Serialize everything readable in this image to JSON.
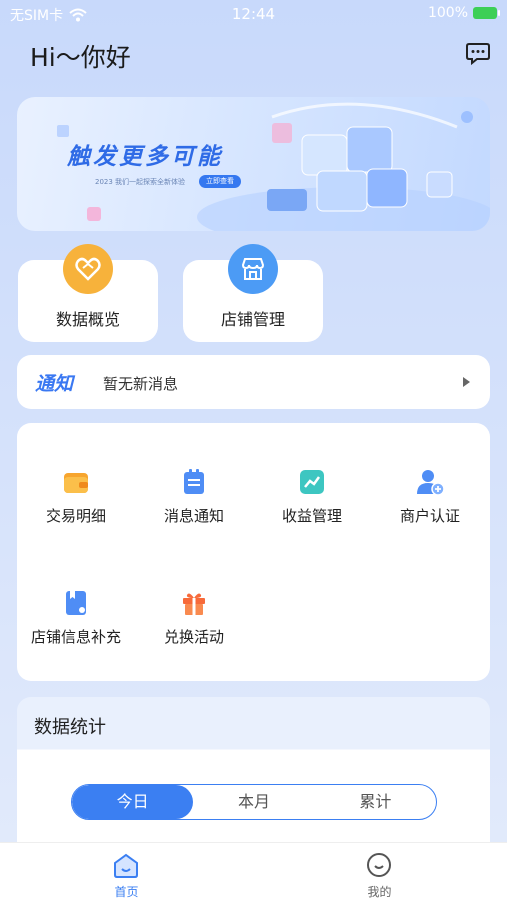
{
  "status_bar": {
    "carrier": "无SIM卡",
    "time": "12:44",
    "battery": "100%"
  },
  "header": {
    "greeting": "Hi～你好",
    "message_icon": "chat-bubble-icon"
  },
  "banner": {
    "title": "触发更多可能",
    "subtitle": "2023 我们一起探索全新体验",
    "button": "立即查看"
  },
  "quick_cards": [
    {
      "label": "数据概览",
      "icon": "heart-icon",
      "color": "#f7b23b"
    },
    {
      "label": "店铺管理",
      "icon": "store-icon",
      "color": "#4c9bf5"
    }
  ],
  "notice": {
    "tag": "通知",
    "text": "暂无新消息"
  },
  "grid": [
    {
      "label": "交易明细",
      "icon": "wallet-icon"
    },
    {
      "label": "消息通知",
      "icon": "calendar-icon"
    },
    {
      "label": "收益管理",
      "icon": "trend-chart-icon"
    },
    {
      "label": "商户认证",
      "icon": "user-add-icon"
    },
    {
      "label": "店铺信息补充",
      "icon": "bookmark-document-icon"
    },
    {
      "label": "兑换活动",
      "icon": "gift-icon"
    }
  ],
  "stats": {
    "title": "数据统计",
    "tabs": [
      "今日",
      "本月",
      "累计"
    ],
    "active_tab": "今日"
  },
  "tabbar": [
    {
      "label": "首页",
      "icon": "home-icon",
      "active": true
    },
    {
      "label": "我的",
      "icon": "profile-icon",
      "active": false
    }
  ],
  "colors": {
    "primary": "#3b7ff2",
    "background": "#c8d9fb"
  }
}
